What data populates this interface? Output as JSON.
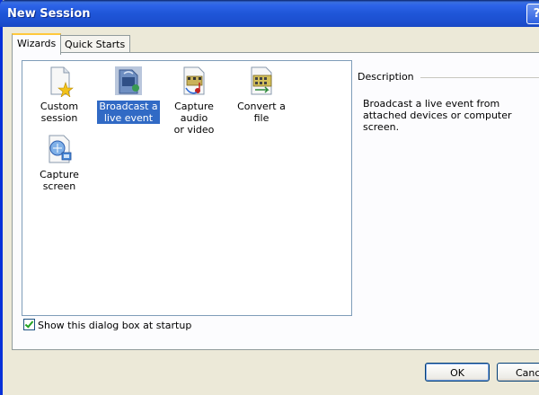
{
  "window": {
    "title": "New Session",
    "help_label": "?"
  },
  "tabs": [
    {
      "label": "Wizards",
      "active": true
    },
    {
      "label": "Quick Starts",
      "active": false
    }
  ],
  "wizards": [
    {
      "label_line1": "Custom",
      "label_line2": "session",
      "icon": "custom-session-icon",
      "selected": false
    },
    {
      "label_line1": "Broadcast a",
      "label_line2": "live event",
      "icon": "broadcast-icon",
      "selected": true
    },
    {
      "label_line1": "Capture audio",
      "label_line2": "or video",
      "icon": "capture-av-icon",
      "selected": false
    },
    {
      "label_line1": "Convert a file",
      "label_line2": "",
      "icon": "convert-file-icon",
      "selected": false
    },
    {
      "label_line1": "Capture",
      "label_line2": "screen",
      "icon": "capture-screen-icon",
      "selected": false
    }
  ],
  "description": {
    "heading": "Description",
    "text": "Broadcast a live event from attached devices or computer screen."
  },
  "startup": {
    "label": "Show this dialog box at startup",
    "checked": true
  },
  "buttons": {
    "ok": "OK",
    "cancel": "Cance"
  },
  "colors": {
    "titlebar": "#1f56d8",
    "selection": "#316ac5",
    "dialog_bg": "#ece9d8"
  }
}
